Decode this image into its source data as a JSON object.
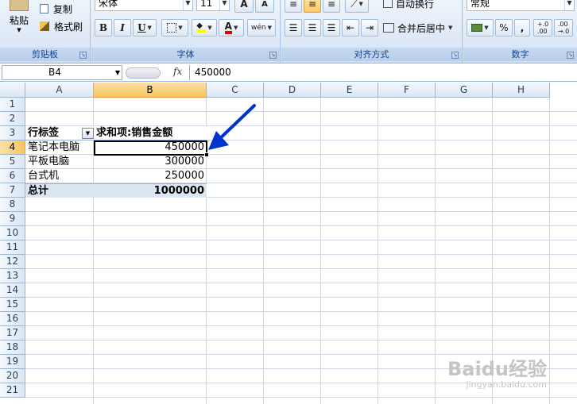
{
  "ribbon": {
    "clipboard": {
      "label": "剪贴板",
      "paste_label": "粘贴",
      "copy_label": "复制",
      "format_painter_label": "格式刷"
    },
    "font": {
      "label": "字体",
      "font_name": "宋体",
      "font_size": "11",
      "bold": "B",
      "italic": "I",
      "underline": "U",
      "grow_font": "A",
      "shrink_font": "A",
      "font_color": "A",
      "phonetic": "wén"
    },
    "alignment": {
      "label": "对齐方式",
      "wrap_text_label": "自动换行",
      "merge_center_label": "合并后居中"
    },
    "number": {
      "label": "数字",
      "format": "常规",
      "percent": "%",
      "comma": ","
    }
  },
  "formula_bar": {
    "name_box": "B4",
    "fx": "fx",
    "value": "450000"
  },
  "columns": [
    "A",
    "B",
    "C",
    "D",
    "E",
    "F",
    "G",
    "H"
  ],
  "active_column": "B",
  "rows": [
    "1",
    "2",
    "3",
    "4",
    "5",
    "6",
    "7",
    "8",
    "9",
    "10",
    "11",
    "12",
    "13",
    "14",
    "15",
    "16",
    "17",
    "18",
    "19",
    "20",
    "21"
  ],
  "active_row": "4",
  "pivot": {
    "row_label_header": "行标签",
    "value_header": "求和项:销售金额",
    "items": [
      {
        "label": "笔记本电脑",
        "value": "450000"
      },
      {
        "label": "平板电脑",
        "value": "300000"
      },
      {
        "label": "台式机",
        "value": "250000"
      }
    ],
    "total_label": "总计",
    "total_value": "1000000"
  },
  "annotation": {
    "arrow_color": "#0033cc"
  },
  "watermark": {
    "brand": "Baidu经验",
    "url": "jingyan.baidu.com"
  }
}
